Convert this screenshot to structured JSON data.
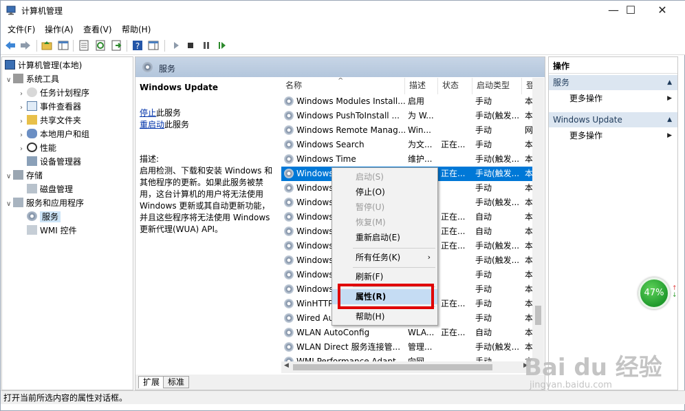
{
  "window": {
    "title": "计算机管理",
    "controls": {
      "minimize": "—",
      "maximize": "☐",
      "close": "✕"
    }
  },
  "menu": [
    "文件(F)",
    "操作(A)",
    "查看(V)",
    "帮助(H)"
  ],
  "tree": {
    "root": "计算机管理(本地)",
    "system_tools": "系统工具",
    "task_scheduler": "任务计划程序",
    "event_viewer": "事件查看器",
    "shared_folders": "共享文件夹",
    "local_users": "本地用户和组",
    "performance": "性能",
    "device_manager": "设备管理器",
    "storage": "存储",
    "disk_mgmt": "磁盘管理",
    "services_apps": "服务和应用程序",
    "services": "服务",
    "wmi": "WMI 控件"
  },
  "middle": {
    "header": "服务",
    "selected_service": "Windows Update",
    "link_stop": "停止",
    "link_stop_suffix": "此服务",
    "link_restart": "重启动",
    "link_restart_suffix": "此服务",
    "desc_label": "描述:",
    "desc_lines": [
      "启用检测、下载和安装 Windows 和",
      "其他程序的更新。如果此服务被禁",
      "用，这台计算机的用户将无法使用",
      "Windows 更新或其自动更新功能，",
      "并且这些程序将无法使用 Windows",
      "更新代理(WUA) API。"
    ],
    "columns": [
      "名称",
      "描述",
      "状态",
      "启动类型",
      "登"
    ],
    "rows": [
      [
        "Windows Modules Install...",
        "启用",
        "",
        "手动",
        "本"
      ],
      [
        "Windows PushToInstall ...",
        "为 W...",
        "",
        "手动(触发...",
        "本"
      ],
      [
        "Windows Remote Manag...",
        "Win...",
        "",
        "手动",
        "网"
      ],
      [
        "Windows Search",
        "为文...",
        "正在...",
        "手动",
        "本"
      ],
      [
        "Windows Time",
        "维护...",
        "",
        "手动(触发...",
        "本"
      ],
      [
        "Windows",
        "",
        "正在...",
        "手动(触发...",
        "本"
      ],
      [
        "Windows",
        "",
        "",
        "手动",
        "本"
      ],
      [
        "Windows",
        "",
        "",
        "手动(触发...",
        "本"
      ],
      [
        "Windows",
        "",
        "正在...",
        "自动",
        "本"
      ],
      [
        "Windows",
        "",
        "正在...",
        "自动",
        "本"
      ],
      [
        "Windows",
        "",
        "正在...",
        "手动(触发...",
        "本"
      ],
      [
        "Windows",
        "",
        "",
        "手动(触发...",
        "本"
      ],
      [
        "Windows",
        "",
        "",
        "手动",
        "本"
      ],
      [
        "Windows",
        "",
        "",
        "手动",
        "本"
      ],
      [
        "WinHTTP",
        "",
        "正在...",
        "手动",
        "本"
      ],
      [
        "Wired Au",
        "",
        "",
        "手动",
        "本"
      ],
      [
        "WLAN AutoConfig",
        "WLA...",
        "正在...",
        "自动",
        "本"
      ],
      [
        "WLAN Direct 服务连接管...",
        "管理...",
        "",
        "手动(触发...",
        "本"
      ],
      [
        "WMI Performance Adapt...",
        "向网...",
        "",
        "手动",
        "本"
      ]
    ],
    "tabs": [
      "扩展",
      "标准"
    ]
  },
  "actions": {
    "header": "操作",
    "section1": "服务",
    "more1": "更多操作",
    "section2": "Windows Update",
    "more2": "更多操作"
  },
  "context_menu": [
    {
      "label": "启动(S)",
      "disabled": true
    },
    {
      "label": "停止(O)",
      "disabled": false
    },
    {
      "label": "暂停(U)",
      "disabled": true
    },
    {
      "label": "恢复(M)",
      "disabled": true
    },
    {
      "label": "重新启动(E)",
      "disabled": false
    },
    {
      "label": "所有任务(K)",
      "disabled": false
    },
    {
      "label": "刷新(F)",
      "disabled": false
    },
    {
      "label": "属性(R)",
      "disabled": false
    },
    {
      "label": "帮助(H)",
      "disabled": false
    }
  ],
  "status_text": "打开当前所选内容的属性对话框。",
  "widget": {
    "percent": "47%"
  },
  "watermark": {
    "brand": "Bai du 经验",
    "url": "jingyan.baidu.com"
  },
  "colors": {
    "selection": "#0078d7",
    "highlight_box": "#e00000",
    "pane_header": "#b3c6dc"
  }
}
